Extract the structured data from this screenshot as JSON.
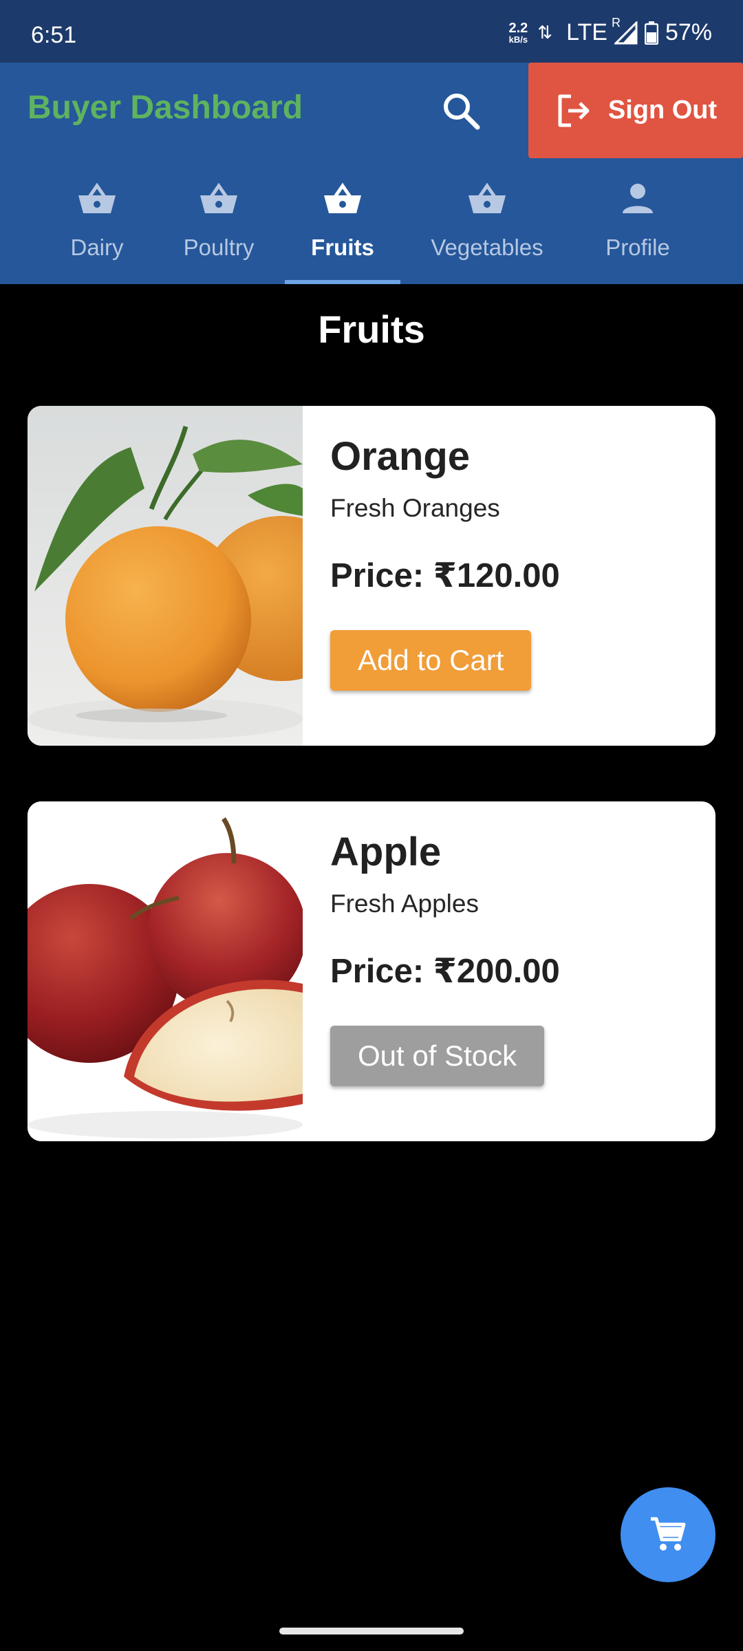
{
  "status_bar": {
    "time": "6:51",
    "net_speed_value": "2.2",
    "net_speed_unit": "kB/s",
    "network": "LTE",
    "roaming": "R",
    "battery": "57%"
  },
  "header": {
    "title": "Buyer Dashboard",
    "sign_out_label": "Sign Out",
    "title_color": "#5fb35f",
    "bar_color": "#25579a",
    "sign_out_color": "#e05442"
  },
  "tabs": [
    {
      "label": "Dairy",
      "icon": "basket-icon",
      "active": false
    },
    {
      "label": "Poultry",
      "icon": "basket-icon",
      "active": false
    },
    {
      "label": "Fruits",
      "icon": "basket-icon",
      "active": true
    },
    {
      "label": "Vegetables",
      "icon": "basket-icon",
      "active": false
    },
    {
      "label": "Profile",
      "icon": "person-icon",
      "active": false
    }
  ],
  "page_title": "Fruits",
  "products": [
    {
      "name": "Orange",
      "description": "Fresh Oranges",
      "price": "Price: ₹120.00",
      "action_label": "Add to Cart",
      "in_stock": true
    },
    {
      "name": "Apple",
      "description": "Fresh Apples",
      "price": "Price: ₹200.00",
      "action_label": "Out of Stock",
      "in_stock": false
    }
  ],
  "fab": {
    "icon": "cart-icon",
    "color": "#3f8ef0"
  }
}
